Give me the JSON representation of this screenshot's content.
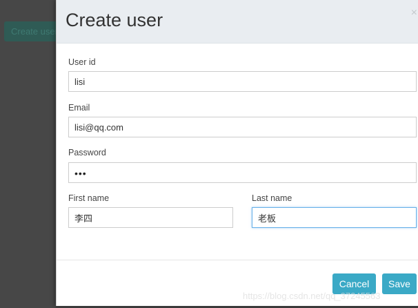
{
  "background": {
    "button_label": "Create user"
  },
  "modal": {
    "title": "Create user",
    "close_glyph": "×",
    "fields": {
      "user_id": {
        "label": "User id",
        "value": "lisi"
      },
      "email": {
        "label": "Email",
        "value": "lisi@qq.com"
      },
      "password": {
        "label": "Password",
        "masked": "•••"
      },
      "first_name": {
        "label": "First name",
        "value": "李四"
      },
      "last_name": {
        "label": "Last name",
        "value": "老板"
      }
    },
    "footer": {
      "cancel_label": "Cancel",
      "save_label": "Save"
    }
  },
  "watermark": "https://blog.csdn.net/qq_37245563",
  "colors": {
    "primary_button": "#3aa9c6",
    "header_bg": "#e9edf1",
    "focus_border": "#66afe9"
  },
  "icons": {
    "close": "close-icon"
  }
}
